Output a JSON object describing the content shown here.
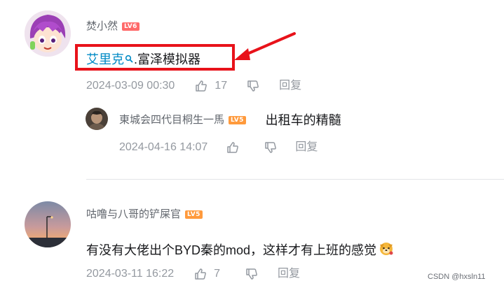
{
  "comments": [
    {
      "username": "焚小然",
      "level": "LV6",
      "link_text": "艾里克",
      "text": ".富泽模拟器",
      "time": "2024-03-09 00:30",
      "likes": "17",
      "reply_label": "回复"
    },
    {
      "username": "咕噜与八哥的铲屎官",
      "level": "LV5",
      "text": "有没有大佬出个BYD秦的mod，这样才有上班的感觉",
      "time": "2024-03-11 16:22",
      "likes": "7",
      "reply_label": "回复"
    }
  ],
  "replies": [
    {
      "username": "東城会四代目桐生一馬",
      "level": "LV5",
      "text": "出租车的精髓",
      "time": "2024-04-16 14:07",
      "reply_label": "回复"
    }
  ],
  "watermark": "CSDN @hxsln11",
  "colors": {
    "highlight_box": "#e8121a",
    "arrow": "#e8121a",
    "lv6": "#ff6a6a",
    "lv5": "#ff9a3c",
    "link": "#008ac5"
  }
}
